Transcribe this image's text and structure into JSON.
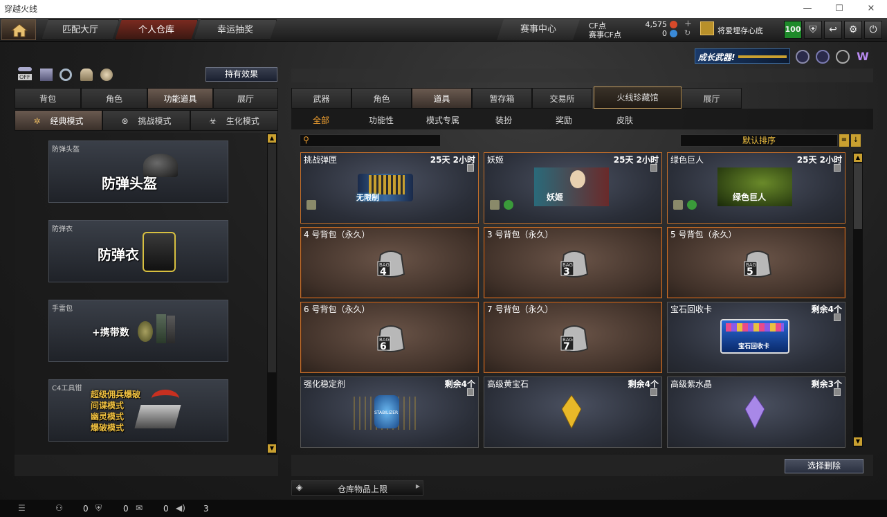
{
  "window": {
    "title": "穿越火线",
    "min": "—",
    "max": "☐",
    "close": "✕"
  },
  "nav": {
    "tabs": [
      "匹配大厅",
      "个人仓库",
      "幸运抽奖"
    ],
    "event": "赛事中心",
    "cf_label": "CF点",
    "cf_value": "4,575",
    "match_cf_label": "赛事CF点",
    "match_cf_value": "0",
    "clan": "将爱埋存心底",
    "level": "100"
  },
  "banner": {
    "text": "成长武器!"
  },
  "left": {
    "effect_button": "持有效果",
    "off_label": "OFF",
    "tabs": [
      "背包",
      "角色",
      "功能道具",
      "展厅"
    ],
    "modes": [
      "经典模式",
      "挑战模式",
      "生化模式"
    ],
    "categories": [
      {
        "label": "防弹头盔",
        "big": "防弹头盔"
      },
      {
        "label": "防弹衣",
        "big": "防弹衣"
      },
      {
        "label": "手雷包",
        "big": "+携带数"
      },
      {
        "label": "C4工具钳",
        "lines": [
          "超级佣兵爆破",
          "间谍模式",
          "幽灵模式",
          "爆破模式"
        ]
      }
    ]
  },
  "right": {
    "tabs": [
      "武器",
      "角色",
      "道具",
      "暂存箱",
      "交易所",
      "火线珍藏馆",
      "展厅"
    ],
    "subtabs": [
      "全部",
      "功能性",
      "模式专属",
      "装扮",
      "奖励",
      "皮肤"
    ],
    "sort": "默认排序",
    "items": [
      {
        "name": "挑战弹匣",
        "time": "25天 2小时",
        "art": "无限制",
        "style": "blue"
      },
      {
        "name": "妖姬",
        "time": "25天 2小时",
        "art": "妖姬",
        "style": "blue"
      },
      {
        "name": "绿色巨人",
        "time": "25天 2小时",
        "art": "绿色巨人",
        "style": "blue"
      },
      {
        "name": "4 号背包（永久）",
        "time": "",
        "art": "4",
        "style": "brown"
      },
      {
        "name": "3 号背包（永久）",
        "time": "",
        "art": "3",
        "style": "brown"
      },
      {
        "name": "5 号背包（永久）",
        "time": "",
        "art": "5",
        "style": "brown"
      },
      {
        "name": "6 号背包（永久）",
        "time": "",
        "art": "6",
        "style": "brown"
      },
      {
        "name": "7 号背包（永久）",
        "time": "",
        "art": "7",
        "style": "brown"
      },
      {
        "name": "宝石回收卡",
        "time": "剩余4个",
        "art": "宝石回收卡",
        "style": "blue"
      },
      {
        "name": "强化稳定剂",
        "time": "剩余4个",
        "art": "STABILIZER",
        "style": "blue"
      },
      {
        "name": "高级黄宝石",
        "time": "剩余4个",
        "art": "",
        "style": "blue"
      },
      {
        "name": "高级紫水晶",
        "time": "剩余3个",
        "art": "",
        "style": "blue"
      }
    ],
    "bag_label": "BAG",
    "delete_button": "选择删除",
    "limit_button": "仓库物品上限"
  },
  "status": {
    "v1": "0",
    "v2": "0",
    "v3": "0",
    "v4": "3"
  }
}
